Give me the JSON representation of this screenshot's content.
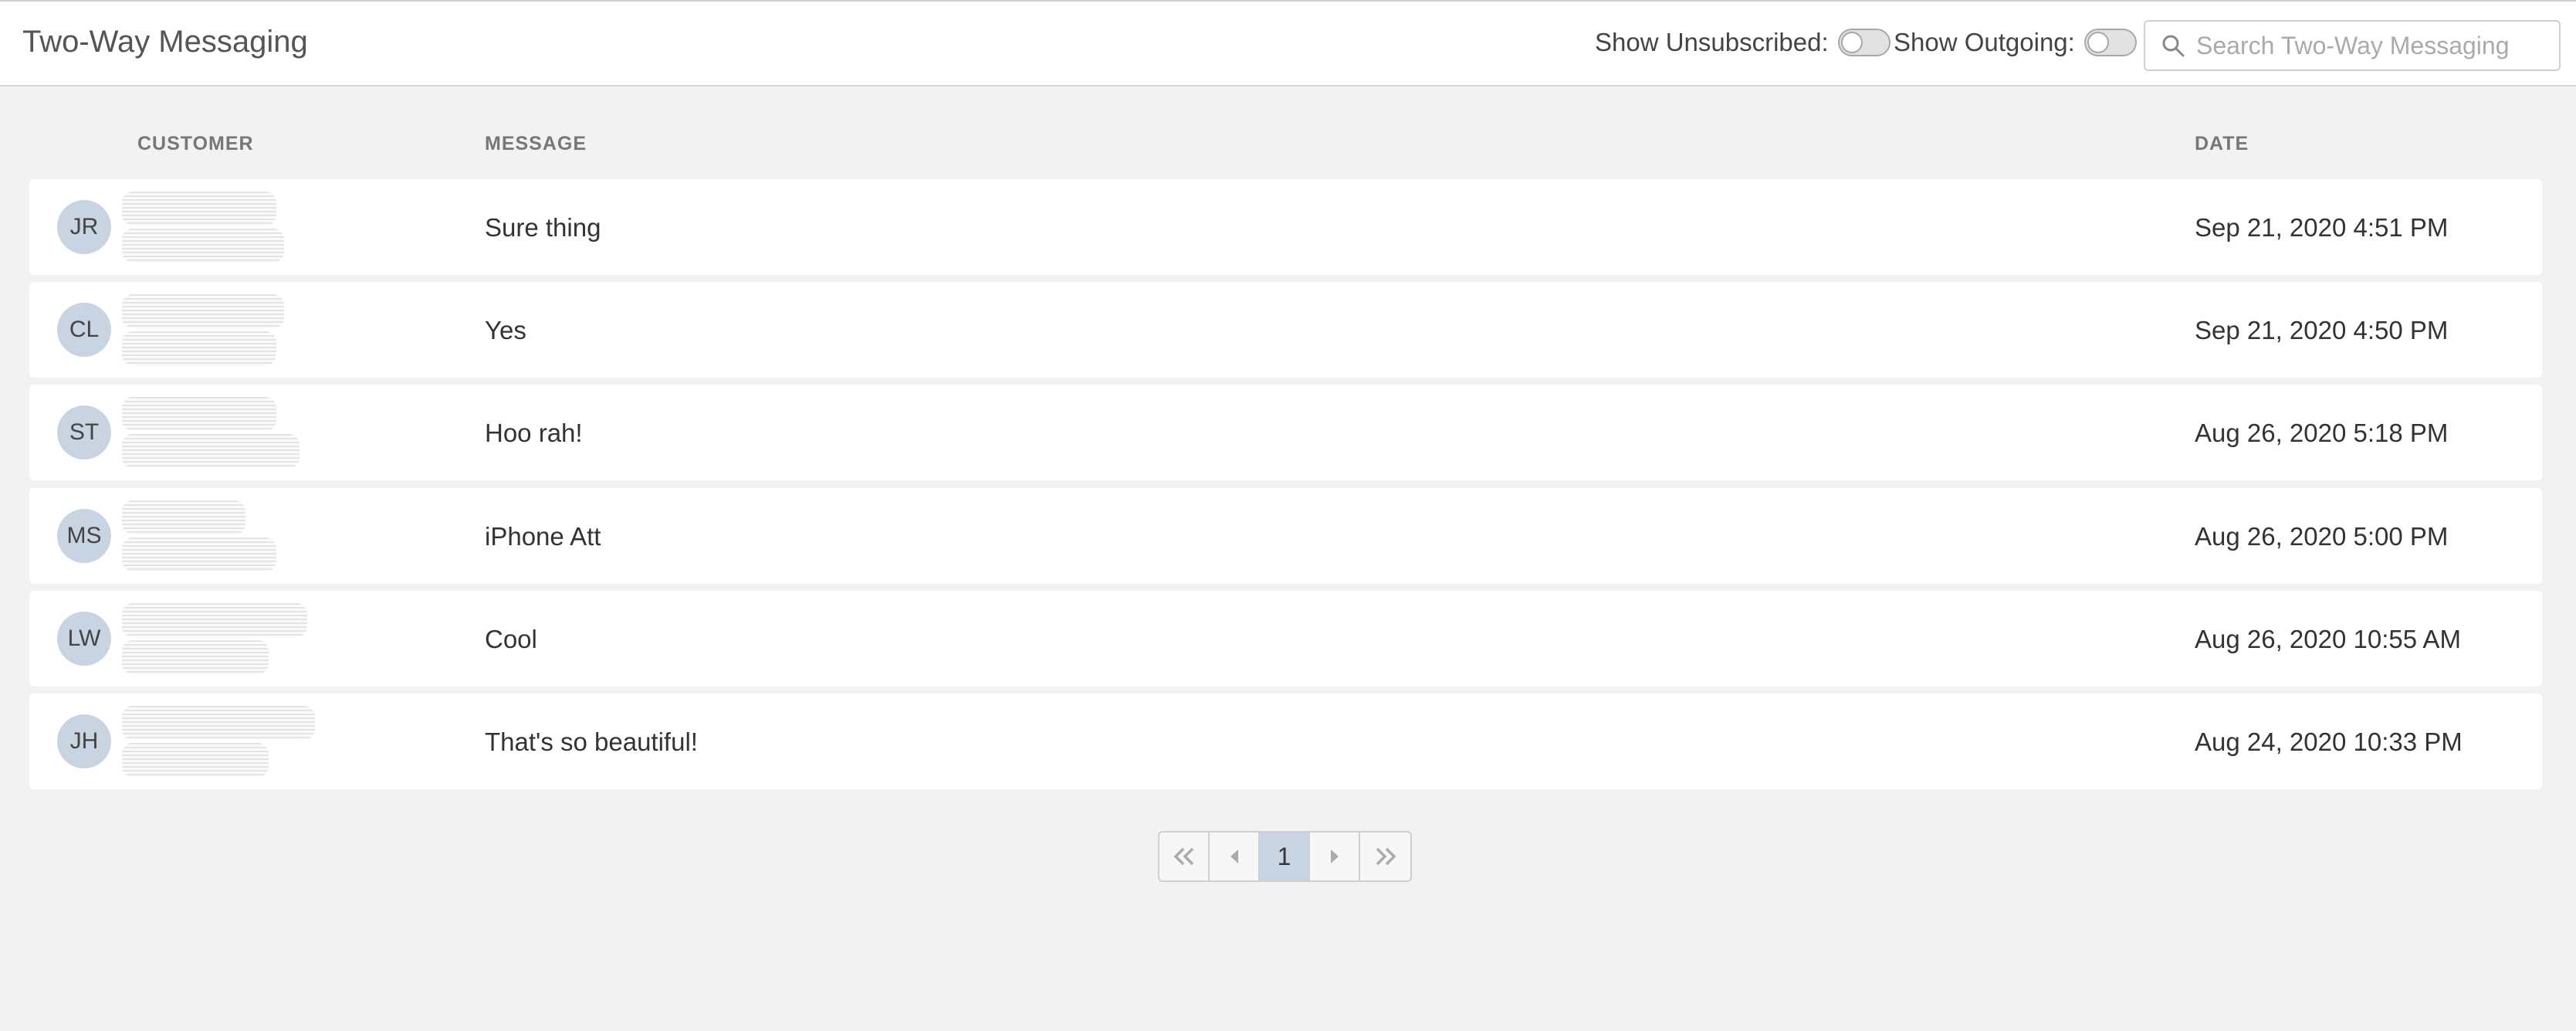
{
  "header": {
    "title": "Two-Way Messaging",
    "toggles": [
      {
        "label": "Show Unsubscribed:",
        "on": false
      },
      {
        "label": "Show Outgoing:",
        "on": false
      }
    ],
    "search": {
      "placeholder": "Search Two-Way Messaging",
      "value": ""
    }
  },
  "table": {
    "columns": {
      "customer": "CUSTOMER",
      "message": "MESSAGE",
      "date": "DATE"
    },
    "rows": [
      {
        "initials": "JR",
        "message": "Sure thing",
        "date": "Sep 21, 2020 4:51 PM"
      },
      {
        "initials": "CL",
        "message": "Yes",
        "date": "Sep 21, 2020 4:50 PM"
      },
      {
        "initials": "ST",
        "message": "Hoo rah!",
        "date": "Aug 26, 2020 5:18 PM"
      },
      {
        "initials": "MS",
        "message": "iPhone Att",
        "date": "Aug 26, 2020 5:00 PM"
      },
      {
        "initials": "LW",
        "message": "Cool",
        "date": "Aug 26, 2020 10:55 AM"
      },
      {
        "initials": "JH",
        "message": "That's so beautiful!",
        "date": "Aug 24, 2020 10:33 PM"
      }
    ]
  },
  "pagination": {
    "current_page": "1",
    "buttons": [
      "first-page-icon",
      "previous-page-icon",
      "1",
      "next-page-icon",
      "last-page-icon"
    ]
  },
  "colors": {
    "background": "#f2f2f2",
    "avatar": "#c9d4e2",
    "active_page": "#c9d4e2"
  }
}
